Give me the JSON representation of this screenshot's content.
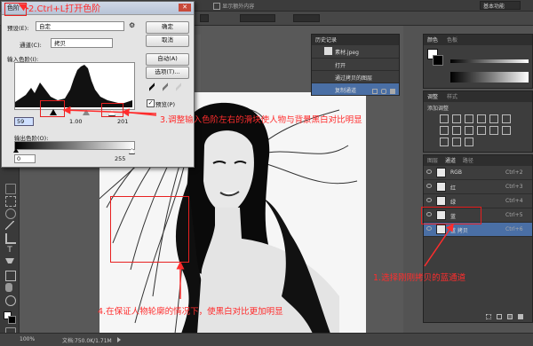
{
  "topbar": {
    "show_extras": "显示额外内容",
    "workspace": "基本功能"
  },
  "dialog": {
    "title": "色阶",
    "preset_label": "预设(E):",
    "preset_value": "自定",
    "channel_label": "通道(C):",
    "channel_value": "拷贝",
    "input_levels_label": "输入色阶(I):",
    "input_values": [
      "59",
      "1.00",
      "201"
    ],
    "output_levels_label": "输出色阶(O):",
    "output_values": [
      "0",
      "255"
    ],
    "buttons": {
      "ok": "确定",
      "cancel": "取消",
      "auto": "自动(A)",
      "options": "选项(T)..."
    },
    "preview_label": "预览(P)"
  },
  "history": {
    "title": "历史记录",
    "source": "素材.jpeg",
    "items": [
      "打开",
      "通过拷贝的图层",
      "复制通道"
    ]
  },
  "right_panels": {
    "color_tabs": [
      "颜色",
      "色板"
    ],
    "adjust_tabs": [
      "调整",
      "样式"
    ],
    "add_adjustment": "添加调整",
    "layer_tabs": [
      "图层",
      "通道",
      "路径"
    ]
  },
  "channels": [
    {
      "name": "RGB",
      "shortcut": "Ctrl+2",
      "selected": false
    },
    {
      "name": "红",
      "shortcut": "Ctrl+3",
      "selected": false
    },
    {
      "name": "绿",
      "shortcut": "Ctrl+4",
      "selected": false
    },
    {
      "name": "蓝",
      "shortcut": "Ctrl+5",
      "selected": false
    },
    {
      "name": "蓝 拷贝",
      "shortcut": "Ctrl+6",
      "selected": true
    }
  ],
  "status": {
    "zoom": "100%",
    "doc": "文档:750.0K/1.71M"
  },
  "annotations": {
    "step1": "1.选择刚刚拷贝的蓝通道",
    "step2": "2.Ctrl+L打开色阶",
    "step3": "3.调整输入色阶左右的滑块使人物与背景黑白对比明显",
    "step4": "4.在保证人物轮廓的情况下，使黑白对比更加明显"
  },
  "colors": {
    "annotation": "#ff2d2d",
    "selection": "#4a6fa5"
  }
}
